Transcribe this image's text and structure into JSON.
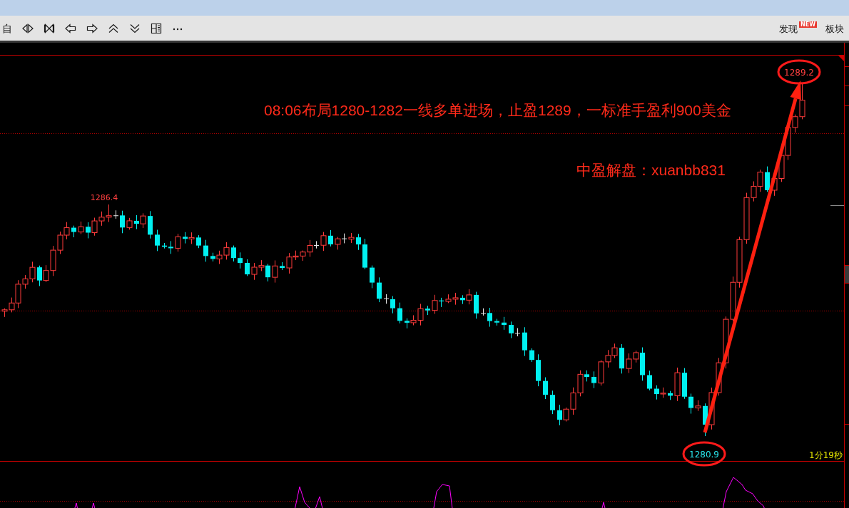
{
  "toolbar": {
    "left_label": "自",
    "links": [
      {
        "label": "发现",
        "badge": "NEW"
      },
      {
        "label": "板块"
      }
    ]
  },
  "chart": {
    "peak_label": "1286.4",
    "callouts": [
      {
        "kind": "high",
        "text": "1289.2"
      },
      {
        "kind": "low",
        "text": "1280.9"
      }
    ],
    "notes": [
      {
        "text": "08:06布局1280-1282一线多单进场，止盈1289，一标准手盈利900美金"
      },
      {
        "text": "中盈解盘：xuanbb831"
      }
    ],
    "timer": "1分19秒"
  }
}
